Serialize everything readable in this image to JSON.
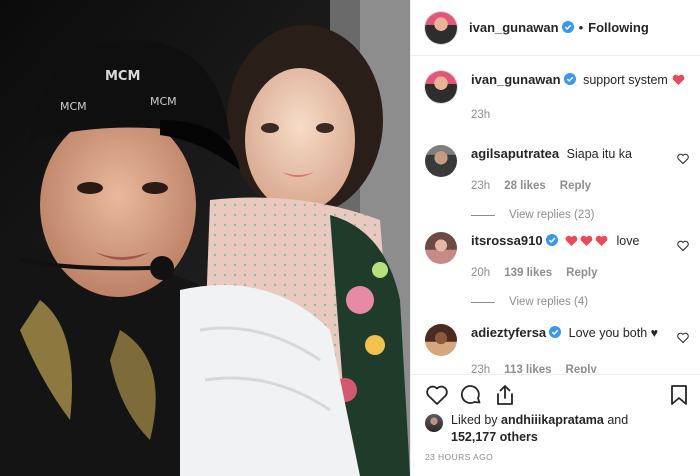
{
  "post": {
    "author": "ivan_gunawan",
    "follow_status": "Following",
    "caption": "support system",
    "caption_age": "23h"
  },
  "comments": [
    {
      "user": "agilsaputratea",
      "verified": false,
      "text": "Siapa itu ka",
      "age": "23h",
      "likes": "28 likes",
      "reply": "Reply",
      "replies": "View replies (23)"
    },
    {
      "user": "itsrossa910",
      "verified": true,
      "text": "love",
      "hearts": 3,
      "age": "20h",
      "likes": "139 likes",
      "reply": "Reply",
      "replies": "View replies (4)"
    },
    {
      "user": "adieztyfersa",
      "verified": true,
      "text": "Love you both ♥",
      "age": "23h",
      "likes": "113 likes",
      "reply": "Reply"
    }
  ],
  "likes_summary": {
    "prefix": "Liked by",
    "user": "andhiiikapratama",
    "joiner": "and",
    "count": "152,177 others"
  },
  "timestamp": "23 HOURS AGO",
  "icons": {
    "like": "heart-outline-icon",
    "comment": "comment-bubble-icon",
    "share": "share-upload-icon",
    "save": "bookmark-icon",
    "verified": "verified-badge-icon"
  },
  "colors": {
    "verified": "#3897f0",
    "heart_red": "#ed4956",
    "muted": "#8e8e8e"
  }
}
